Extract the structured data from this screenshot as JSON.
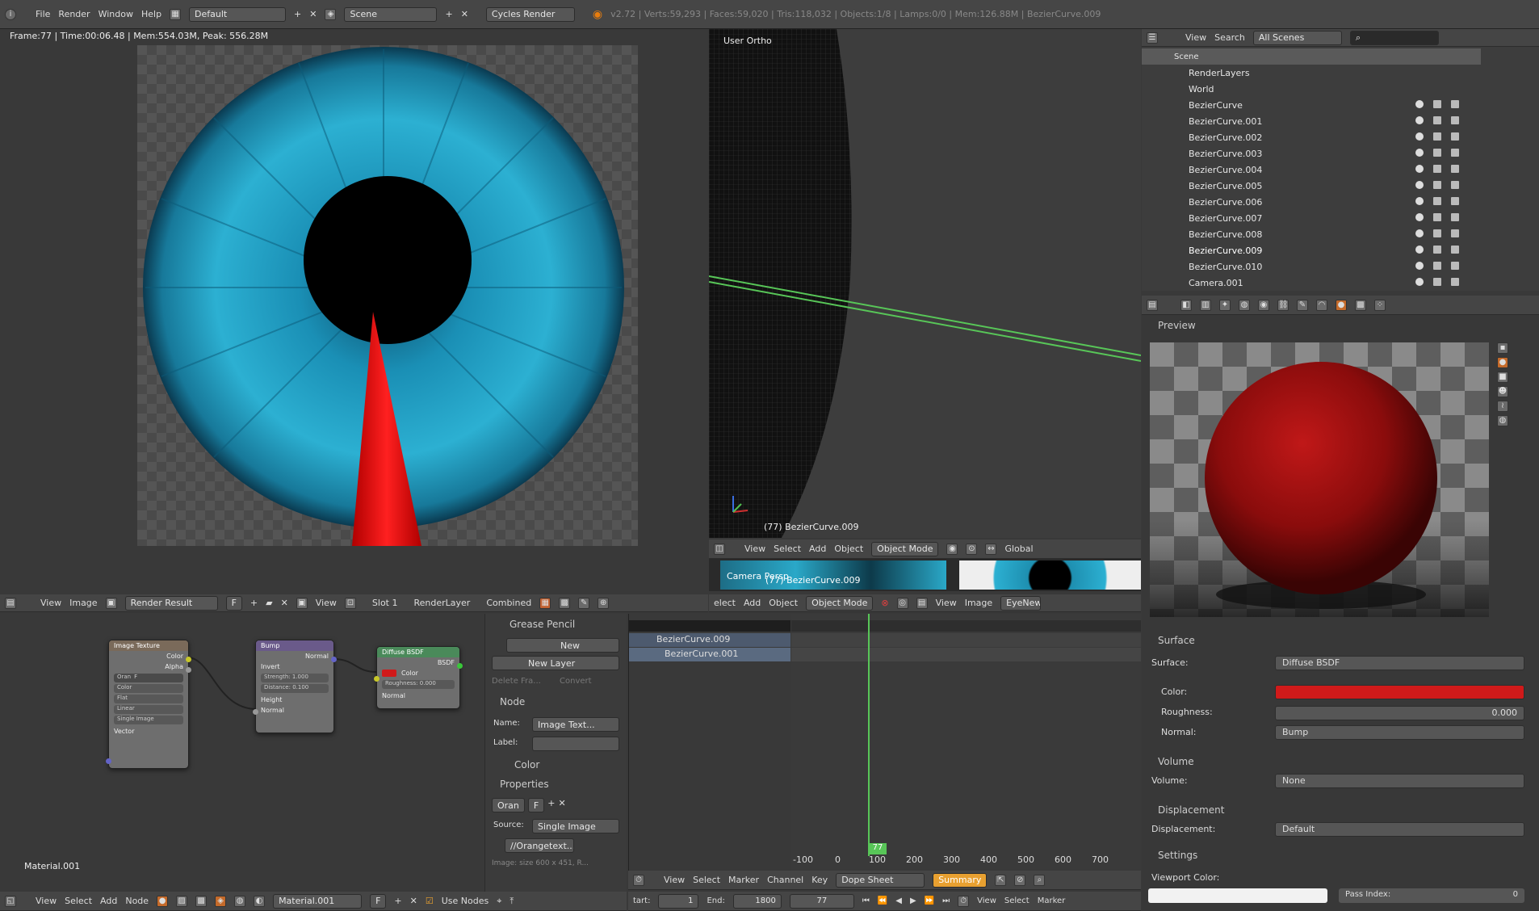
{
  "top_bar": {
    "menu": [
      "File",
      "Render",
      "Window",
      "Help"
    ],
    "layout": "Default",
    "scene": "Scene",
    "engine": "Cycles Render",
    "stats": "v2.72 | Verts:59,293 | Faces:59,020 | Tris:118,032 | Objects:1/8 | Lamps:0/0 | Mem:126.88M | BezierCurve.009"
  },
  "image_editor": {
    "info": "Frame:77 | Time:00:06.48 | Mem:554.03M, Peak: 556.28M",
    "header": {
      "view": "View",
      "image": "Image",
      "image_name": "Render Result",
      "f": "F",
      "view2": "View",
      "slot": "Slot 1",
      "layer": "RenderLayer",
      "pass": "Combined"
    }
  },
  "viewport": {
    "label": "User Ortho",
    "object_label": "(77) BezierCurve.009",
    "header": [
      "View",
      "Select",
      "Add",
      "Object"
    ],
    "mode": "Object Mode",
    "orientation": "Global"
  },
  "camera_strip": {
    "left_label": "Camera Persp",
    "left_obj": "(77) BezierCurve.009",
    "header": [
      "elect",
      "Add",
      "Object"
    ],
    "mode": "Object Mode",
    "view": "View",
    "image": "Image",
    "image_name": "EyeNewC"
  },
  "outliner": {
    "header": {
      "view": "View",
      "search": "Search",
      "scenes": "All Scenes"
    },
    "items": [
      {
        "name": "Scene"
      },
      {
        "name": "RenderLayers"
      },
      {
        "name": "World"
      },
      {
        "name": "BezierCurve"
      },
      {
        "name": "BezierCurve.001"
      },
      {
        "name": "BezierCurve.002"
      },
      {
        "name": "BezierCurve.003"
      },
      {
        "name": "BezierCurve.004"
      },
      {
        "name": "BezierCurve.005"
      },
      {
        "name": "BezierCurve.006"
      },
      {
        "name": "BezierCurve.007"
      },
      {
        "name": "BezierCurve.008"
      },
      {
        "name": "BezierCurve.009"
      },
      {
        "name": "BezierCurve.010"
      },
      {
        "name": "Camera.001"
      }
    ]
  },
  "properties": {
    "preview": "Preview",
    "surface_section": "Surface",
    "surface_label": "Surface:",
    "surface_value": "Diffuse BSDF",
    "color_label": "Color:",
    "roughness_label": "Roughness:",
    "roughness_value": "0.000",
    "normal_label": "Normal:",
    "normal_value": "Bump",
    "volume_section": "Volume",
    "volume_label": "Volume:",
    "volume_value": "None",
    "displacement_section": "Displacement",
    "displacement_label": "Displacement:",
    "displacement_value": "Default",
    "settings_section": "Settings",
    "viewport_color_label": "Viewport Color:",
    "pass_index_label": "Pass Index:",
    "pass_index_value": "0",
    "accent_color": "#d01a1a"
  },
  "node_editor": {
    "material_label": "Material.001",
    "image_texture": {
      "title": "Image Texture",
      "out_color": "Color",
      "out_alpha": "Alpha",
      "img": "Oran",
      "f": "F",
      "opts": [
        "Color",
        "Flat",
        "Linear",
        "Single Image"
      ],
      "in_vector": "Vector"
    },
    "bump": {
      "title": "Bump",
      "out_normal": "Normal",
      "invert": "Invert",
      "strength": "Strength: 1.000",
      "distance": "Distance: 0.100",
      "in_height": "Height",
      "in_normal": "Normal"
    },
    "diffuse": {
      "title": "Diffuse BSDF",
      "out_bsdf": "BSDF",
      "in_color": "Color",
      "roughness": "Roughness: 0.000",
      "in_normal": "Normal"
    },
    "footer": {
      "view": "View",
      "select": "Select",
      "add": "Add",
      "node": "Node",
      "material": "Material.001",
      "f": "F",
      "use_nodes": "Use Nodes"
    }
  },
  "node_sidebar": {
    "grease_pencil": "Grease Pencil",
    "new": "New",
    "new_layer": "New Layer",
    "delete_frame": "Delete Fra...",
    "convert": "Convert",
    "node_section": "Node",
    "name_label": "Name:",
    "name_value": "Image Text...",
    "label_label": "Label:",
    "color_section": "Color",
    "properties_section": "Properties",
    "prop_img": "Oran",
    "prop_f": "F",
    "source_label": "Source:",
    "source_value": "Single Image",
    "file_path": "//Orangetext...",
    "image_size": "Image: size 600 x 451, R..."
  },
  "dopesheet": {
    "items": [
      "BezierCurve.009",
      "BezierCurve.001"
    ],
    "ticks": [
      "-100",
      "0",
      "100",
      "200",
      "300",
      "400",
      "500",
      "600",
      "700"
    ],
    "current_frame": "77",
    "header": [
      "View",
      "Select",
      "Marker",
      "Channel",
      "Key"
    ],
    "mode": "Dope Sheet",
    "summary": "Summary"
  },
  "timeline": {
    "start_label": "tart:",
    "start_value": "1",
    "end_label": "End:",
    "end_value": "1800",
    "frame": "77",
    "right": [
      "View",
      "Select",
      "Marker"
    ]
  }
}
